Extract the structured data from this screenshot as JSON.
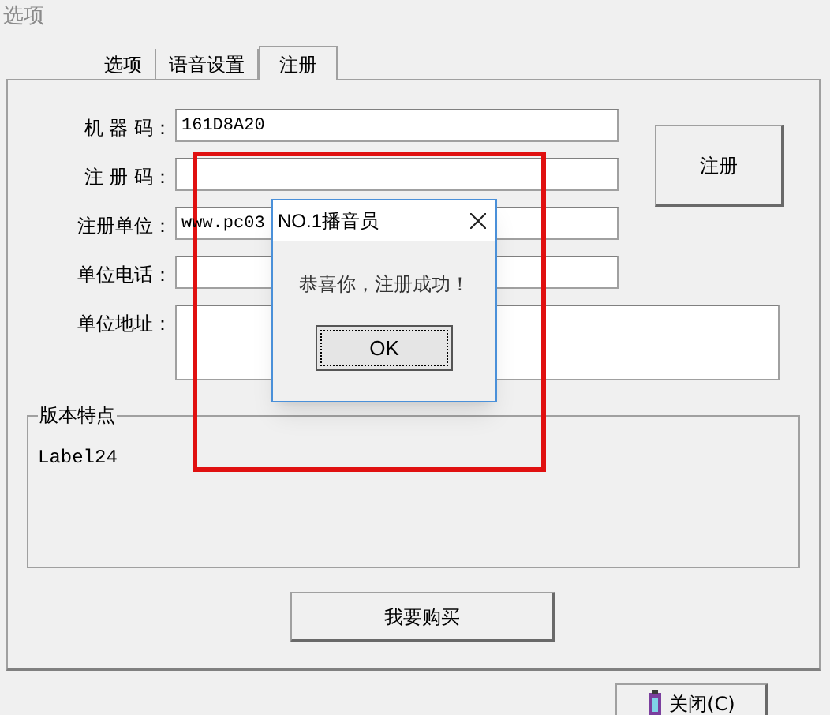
{
  "window": {
    "title": "选项"
  },
  "tabs": [
    {
      "label": "选项",
      "selected": false
    },
    {
      "label": "语音设置",
      "selected": false
    },
    {
      "label": "注册",
      "selected": true
    }
  ],
  "form": {
    "fields": [
      {
        "label": "机 器 码：",
        "value": "161D8A20",
        "kind": "line"
      },
      {
        "label": "注 册 码：",
        "kind": "line"
      },
      {
        "label": "注册单位：",
        "value": "www.pc03",
        "kind": "line"
      },
      {
        "label": "单位电话：",
        "kind": "line"
      },
      {
        "label": "单位地址：",
        "kind": "multiline"
      }
    ],
    "register_button": "注册"
  },
  "features": {
    "title": "版本特点",
    "text": "Label24"
  },
  "buy_button": "我要购买",
  "close_button": "关闭(C)",
  "dialog": {
    "title": "NO.1播音员",
    "message": "恭喜你，注册成功！",
    "ok_button": "OK"
  },
  "highlight": {
    "kind": "rectangle"
  }
}
